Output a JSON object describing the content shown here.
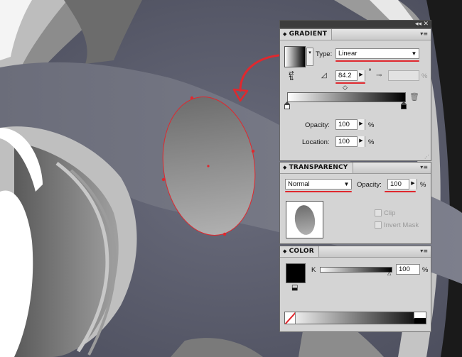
{
  "gradient_panel": {
    "title": "GRADIENT",
    "type_label": "Type:",
    "type_value": "Linear",
    "angle_value": "84.2",
    "angle_unit": "°",
    "aspect_unit": "%",
    "opacity_label": "Opacity:",
    "opacity_value": "100",
    "opacity_unit": "%",
    "location_label": "Location:",
    "location_value": "100",
    "location_unit": "%"
  },
  "transparency_panel": {
    "title": "TRANSPARENCY",
    "blend_mode": "Normal",
    "opacity_label": "Opacity:",
    "opacity_value": "100",
    "opacity_unit": "%",
    "clip_label": "Clip",
    "invert_mask_label": "Invert Mask"
  },
  "color_panel": {
    "title": "COLOR",
    "channel_label": "K",
    "channel_value": "100",
    "channel_unit": "%"
  },
  "window_controls": {
    "collapse": "◂◂",
    "close": "✕"
  },
  "colors": {
    "annotation_red": "#e0282e",
    "canvas_bg": "#5b5d6e",
    "panel_bg": "#d4d4d4"
  }
}
